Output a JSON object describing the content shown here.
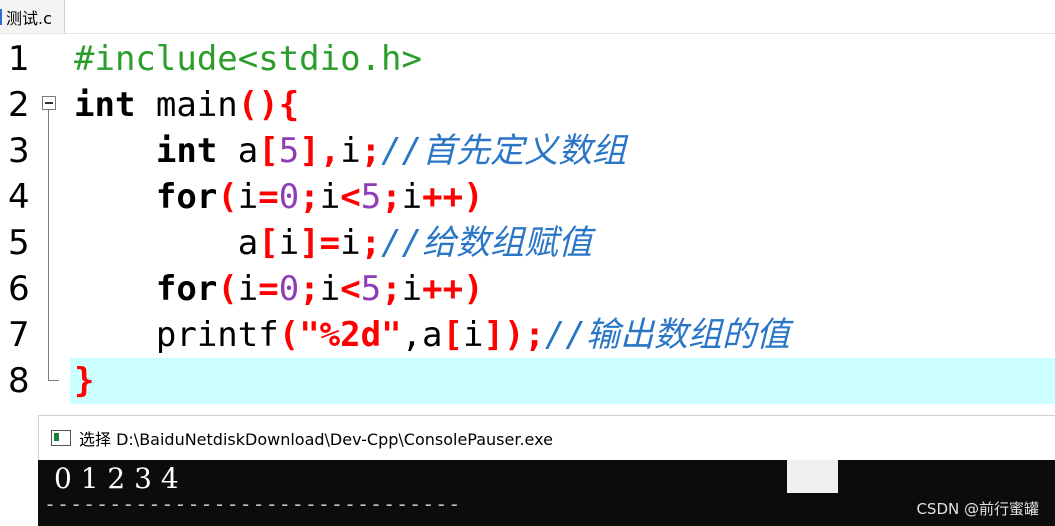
{
  "tab": {
    "label": "测试.c"
  },
  "editor": {
    "line_numbers": [
      "1",
      "2",
      "3",
      "4",
      "5",
      "6",
      "7",
      "8"
    ],
    "lines": [
      [
        {
          "t": "#include<stdio.h>",
          "c": "pp"
        }
      ],
      [
        {
          "t": "int",
          "c": "kw"
        },
        {
          "t": " main",
          "c": ""
        },
        {
          "t": "(){",
          "c": "op"
        }
      ],
      [
        {
          "t": "    ",
          "c": ""
        },
        {
          "t": "int",
          "c": "kw"
        },
        {
          "t": " a",
          "c": ""
        },
        {
          "t": "[",
          "c": "op"
        },
        {
          "t": "5",
          "c": "num"
        },
        {
          "t": "],",
          "c": "op"
        },
        {
          "t": "i",
          "c": ""
        },
        {
          "t": ";",
          "c": "op"
        },
        {
          "t": "//首先定义数组",
          "c": "cm"
        }
      ],
      [
        {
          "t": "    ",
          "c": ""
        },
        {
          "t": "for",
          "c": "kw"
        },
        {
          "t": "(",
          "c": "op"
        },
        {
          "t": "i",
          "c": ""
        },
        {
          "t": "=",
          "c": "op"
        },
        {
          "t": "0",
          "c": "num"
        },
        {
          "t": ";",
          "c": "op"
        },
        {
          "t": "i",
          "c": ""
        },
        {
          "t": "<",
          "c": "op"
        },
        {
          "t": "5",
          "c": "num"
        },
        {
          "t": ";",
          "c": "op"
        },
        {
          "t": "i",
          "c": ""
        },
        {
          "t": "++)",
          "c": "op"
        }
      ],
      [
        {
          "t": "        a",
          "c": ""
        },
        {
          "t": "[",
          "c": "op"
        },
        {
          "t": "i",
          "c": ""
        },
        {
          "t": "]=",
          "c": "op"
        },
        {
          "t": "i",
          "c": ""
        },
        {
          "t": ";",
          "c": "op"
        },
        {
          "t": "//给数组赋值",
          "c": "cm"
        }
      ],
      [
        {
          "t": "    ",
          "c": ""
        },
        {
          "t": "for",
          "c": "kw"
        },
        {
          "t": "(",
          "c": "op"
        },
        {
          "t": "i",
          "c": ""
        },
        {
          "t": "=",
          "c": "op"
        },
        {
          "t": "0",
          "c": "num"
        },
        {
          "t": ";",
          "c": "op"
        },
        {
          "t": "i",
          "c": ""
        },
        {
          "t": "<",
          "c": "op"
        },
        {
          "t": "5",
          "c": "num"
        },
        {
          "t": ";",
          "c": "op"
        },
        {
          "t": "i",
          "c": ""
        },
        {
          "t": "++)",
          "c": "op"
        }
      ],
      [
        {
          "t": "    printf",
          "c": ""
        },
        {
          "t": "(",
          "c": "op"
        },
        {
          "t": "\"%2d\"",
          "c": "str"
        },
        {
          "t": ",a",
          "c": ""
        },
        {
          "t": "[",
          "c": "op"
        },
        {
          "t": "i",
          "c": ""
        },
        {
          "t": "]);",
          "c": "op"
        },
        {
          "t": "//输出数组的值",
          "c": "cm"
        }
      ],
      [
        {
          "t": "}",
          "c": "op"
        }
      ]
    ],
    "highlight_line": 8
  },
  "console": {
    "title": "选择 D:\\BaiduNetdiskDownload\\Dev-Cpp\\ConsolePauser.exe",
    "output": "0 1 2 3 4",
    "separator": "--------------------------------"
  },
  "watermark": "CSDN @前行蜜罐"
}
